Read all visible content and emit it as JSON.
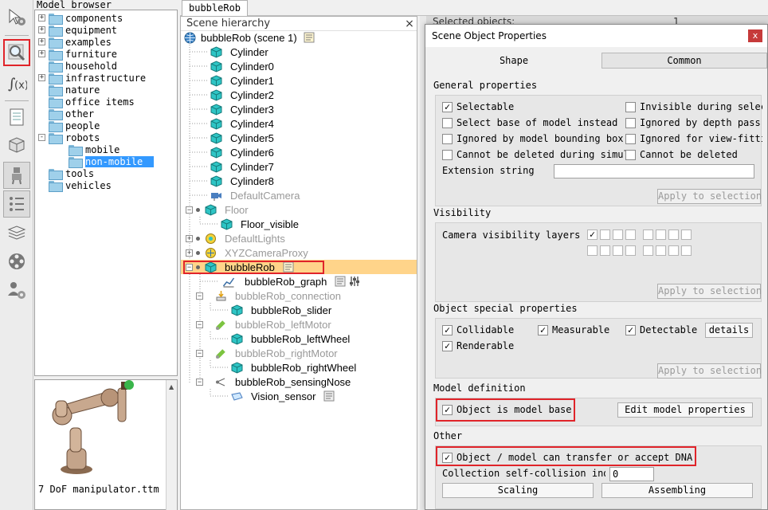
{
  "model_browser": {
    "title": "Model browser",
    "folders": [
      {
        "label": "components",
        "expand": "+"
      },
      {
        "label": "equipment",
        "expand": "+"
      },
      {
        "label": "examples",
        "expand": "+"
      },
      {
        "label": "furniture",
        "expand": "+"
      },
      {
        "label": "household",
        "expand": ""
      },
      {
        "label": "infrastructure",
        "expand": "+"
      },
      {
        "label": "nature",
        "expand": ""
      },
      {
        "label": "office items",
        "expand": ""
      },
      {
        "label": "other",
        "expand": ""
      },
      {
        "label": "people",
        "expand": ""
      },
      {
        "label": "robots",
        "expand": "-"
      },
      {
        "label": "mobile",
        "expand": ""
      },
      {
        "label": "non-mobile",
        "expand": ""
      },
      {
        "label": "tools",
        "expand": ""
      },
      {
        "label": "vehicles",
        "expand": ""
      }
    ],
    "selected": "non-mobile",
    "thumbnail_caption": "7 DoF manipulator.ttm"
  },
  "scene_tab": "bubbleRob",
  "scene_hierarchy": {
    "title": "Scene hierarchy",
    "close": "×",
    "root": "bubbleRob (scene 1)",
    "items": [
      {
        "label": "Cylinder"
      },
      {
        "label": "Cylinder0"
      },
      {
        "label": "Cylinder1"
      },
      {
        "label": "Cylinder2"
      },
      {
        "label": "Cylinder3"
      },
      {
        "label": "Cylinder4"
      },
      {
        "label": "Cylinder5"
      },
      {
        "label": "Cylinder6"
      },
      {
        "label": "Cylinder7"
      },
      {
        "label": "Cylinder8"
      },
      {
        "label": "DefaultCamera"
      },
      {
        "label": "Floor"
      },
      {
        "label": "Floor_visible"
      },
      {
        "label": "DefaultLights"
      },
      {
        "label": "XYZCameraProxy"
      },
      {
        "label": "bubbleRob"
      },
      {
        "label": "bubbleRob_graph"
      },
      {
        "label": "bubbleRob_connection"
      },
      {
        "label": "bubbleRob_slider"
      },
      {
        "label": "bubbleRob_leftMotor"
      },
      {
        "label": "bubbleRob_leftWheel"
      },
      {
        "label": "bubbleRob_rightMotor"
      },
      {
        "label": "bubbleRob_rightWheel"
      },
      {
        "label": "bubbleRob_sensingNose"
      },
      {
        "label": "Vision_sensor"
      }
    ]
  },
  "background_panel": {
    "label": "Selected objects:",
    "value": "1"
  },
  "dialog": {
    "title": "Scene Object Properties",
    "close": "x",
    "tabs": [
      "Shape",
      "Common"
    ],
    "active_tab": "Common",
    "general": {
      "title": "General properties",
      "selectable": "Selectable",
      "invisible": "Invisible during selection",
      "select_base": "Select base of model instead",
      "ignored_depth": "Ignored by depth pass",
      "ignored_bbox": "Ignored by model bounding box",
      "ignored_view": "Ignored for view-fitting",
      "cannot_delete_sim": "Cannot be deleted during simulation",
      "cannot_delete": "Cannot be deleted",
      "extension_label": "Extension string",
      "extension_value": "",
      "apply": "Apply to selection"
    },
    "visibility": {
      "title": "Visibility",
      "camera_layers": "Camera visibility layers",
      "apply": "Apply to selection"
    },
    "special": {
      "title": "Object special properties",
      "collidable": "Collidable",
      "measurable": "Measurable",
      "detectable": "Detectable",
      "details": "details",
      "renderable": "Renderable",
      "apply": "Apply to selection"
    },
    "model": {
      "title": "Model definition",
      "is_model_base": "Object is model base",
      "edit": "Edit model properties"
    },
    "other": {
      "title": "Other",
      "dna": "Object / model can transfer or accept DNA",
      "collection_label": "Collection self-collision indicator",
      "collection_value": "0",
      "scaling": "Scaling",
      "assembling": "Assembling"
    }
  },
  "colors": {
    "highlight": "#e0242a",
    "cube": "#2ec5c5",
    "selection": "#3399ff",
    "row_highlight": "#ffd48a"
  },
  "toolbar_icons": [
    "selection-icon",
    "gear-pointer-icon",
    "magnifier-icon",
    "function-icon",
    "page-icon",
    "box-icon",
    "robot-icon",
    "list-icon",
    "layers-icon",
    "film-icon",
    "user-gear-icon"
  ]
}
